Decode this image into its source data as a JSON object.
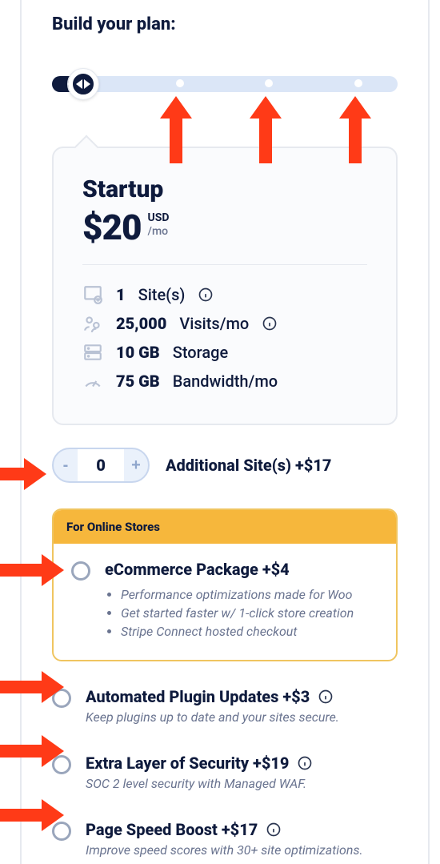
{
  "header": {
    "title": "Build your plan:"
  },
  "plan": {
    "name": "Startup",
    "price": "$20",
    "currency": "USD",
    "period": "/mo",
    "specs": {
      "sites_value": "1",
      "sites_label": "Site(s)",
      "visits_value": "25,000",
      "visits_label": "Visits/mo",
      "storage_value": "10 GB",
      "storage_label": "Storage",
      "bandwidth_value": "75 GB",
      "bandwidth_label": "Bandwidth/mo"
    }
  },
  "sites_stepper": {
    "minus": "-",
    "value": "0",
    "plus": "+",
    "label": "Additional Site(s) +$17"
  },
  "ecommerce": {
    "badge": "For Online Stores",
    "title": "eCommerce Package +$4",
    "bullets": [
      "Performance optimizations made for Woo",
      "Get started faster w/ 1-click store creation",
      "Stripe Connect hosted checkout"
    ]
  },
  "addons": [
    {
      "title": "Automated Plugin Updates +$3",
      "desc": "Keep plugins up to date and your sites secure."
    },
    {
      "title": "Extra Layer of Security +$19",
      "desc": "SOC 2 level security with Managed WAF."
    },
    {
      "title": "Page Speed Boost +$17",
      "desc": "Improve speed scores with 30+ site optimizations."
    }
  ]
}
